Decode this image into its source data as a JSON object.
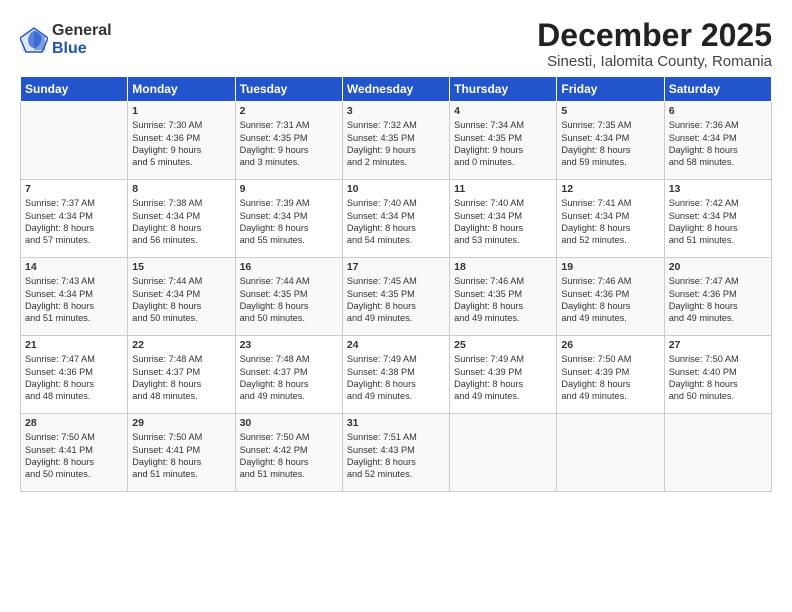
{
  "logo": {
    "general": "General",
    "blue": "Blue"
  },
  "title": "December 2025",
  "subtitle": "Sinesti, Ialomita County, Romania",
  "days_header": [
    "Sunday",
    "Monday",
    "Tuesday",
    "Wednesday",
    "Thursday",
    "Friday",
    "Saturday"
  ],
  "weeks": [
    [
      {
        "num": "",
        "info": ""
      },
      {
        "num": "1",
        "info": "Sunrise: 7:30 AM\nSunset: 4:36 PM\nDaylight: 9 hours\nand 5 minutes."
      },
      {
        "num": "2",
        "info": "Sunrise: 7:31 AM\nSunset: 4:35 PM\nDaylight: 9 hours\nand 3 minutes."
      },
      {
        "num": "3",
        "info": "Sunrise: 7:32 AM\nSunset: 4:35 PM\nDaylight: 9 hours\nand 2 minutes."
      },
      {
        "num": "4",
        "info": "Sunrise: 7:34 AM\nSunset: 4:35 PM\nDaylight: 9 hours\nand 0 minutes."
      },
      {
        "num": "5",
        "info": "Sunrise: 7:35 AM\nSunset: 4:34 PM\nDaylight: 8 hours\nand 59 minutes."
      },
      {
        "num": "6",
        "info": "Sunrise: 7:36 AM\nSunset: 4:34 PM\nDaylight: 8 hours\nand 58 minutes."
      }
    ],
    [
      {
        "num": "7",
        "info": "Sunrise: 7:37 AM\nSunset: 4:34 PM\nDaylight: 8 hours\nand 57 minutes."
      },
      {
        "num": "8",
        "info": "Sunrise: 7:38 AM\nSunset: 4:34 PM\nDaylight: 8 hours\nand 56 minutes."
      },
      {
        "num": "9",
        "info": "Sunrise: 7:39 AM\nSunset: 4:34 PM\nDaylight: 8 hours\nand 55 minutes."
      },
      {
        "num": "10",
        "info": "Sunrise: 7:40 AM\nSunset: 4:34 PM\nDaylight: 8 hours\nand 54 minutes."
      },
      {
        "num": "11",
        "info": "Sunrise: 7:40 AM\nSunset: 4:34 PM\nDaylight: 8 hours\nand 53 minutes."
      },
      {
        "num": "12",
        "info": "Sunrise: 7:41 AM\nSunset: 4:34 PM\nDaylight: 8 hours\nand 52 minutes."
      },
      {
        "num": "13",
        "info": "Sunrise: 7:42 AM\nSunset: 4:34 PM\nDaylight: 8 hours\nand 51 minutes."
      }
    ],
    [
      {
        "num": "14",
        "info": "Sunrise: 7:43 AM\nSunset: 4:34 PM\nDaylight: 8 hours\nand 51 minutes."
      },
      {
        "num": "15",
        "info": "Sunrise: 7:44 AM\nSunset: 4:34 PM\nDaylight: 8 hours\nand 50 minutes."
      },
      {
        "num": "16",
        "info": "Sunrise: 7:44 AM\nSunset: 4:35 PM\nDaylight: 8 hours\nand 50 minutes."
      },
      {
        "num": "17",
        "info": "Sunrise: 7:45 AM\nSunset: 4:35 PM\nDaylight: 8 hours\nand 49 minutes."
      },
      {
        "num": "18",
        "info": "Sunrise: 7:46 AM\nSunset: 4:35 PM\nDaylight: 8 hours\nand 49 minutes."
      },
      {
        "num": "19",
        "info": "Sunrise: 7:46 AM\nSunset: 4:36 PM\nDaylight: 8 hours\nand 49 minutes."
      },
      {
        "num": "20",
        "info": "Sunrise: 7:47 AM\nSunset: 4:36 PM\nDaylight: 8 hours\nand 49 minutes."
      }
    ],
    [
      {
        "num": "21",
        "info": "Sunrise: 7:47 AM\nSunset: 4:36 PM\nDaylight: 8 hours\nand 48 minutes."
      },
      {
        "num": "22",
        "info": "Sunrise: 7:48 AM\nSunset: 4:37 PM\nDaylight: 8 hours\nand 48 minutes."
      },
      {
        "num": "23",
        "info": "Sunrise: 7:48 AM\nSunset: 4:37 PM\nDaylight: 8 hours\nand 49 minutes."
      },
      {
        "num": "24",
        "info": "Sunrise: 7:49 AM\nSunset: 4:38 PM\nDaylight: 8 hours\nand 49 minutes."
      },
      {
        "num": "25",
        "info": "Sunrise: 7:49 AM\nSunset: 4:39 PM\nDaylight: 8 hours\nand 49 minutes."
      },
      {
        "num": "26",
        "info": "Sunrise: 7:50 AM\nSunset: 4:39 PM\nDaylight: 8 hours\nand 49 minutes."
      },
      {
        "num": "27",
        "info": "Sunrise: 7:50 AM\nSunset: 4:40 PM\nDaylight: 8 hours\nand 50 minutes."
      }
    ],
    [
      {
        "num": "28",
        "info": "Sunrise: 7:50 AM\nSunset: 4:41 PM\nDaylight: 8 hours\nand 50 minutes."
      },
      {
        "num": "29",
        "info": "Sunrise: 7:50 AM\nSunset: 4:41 PM\nDaylight: 8 hours\nand 51 minutes."
      },
      {
        "num": "30",
        "info": "Sunrise: 7:50 AM\nSunset: 4:42 PM\nDaylight: 8 hours\nand 51 minutes."
      },
      {
        "num": "31",
        "info": "Sunrise: 7:51 AM\nSunset: 4:43 PM\nDaylight: 8 hours\nand 52 minutes."
      },
      {
        "num": "",
        "info": ""
      },
      {
        "num": "",
        "info": ""
      },
      {
        "num": "",
        "info": ""
      }
    ]
  ]
}
